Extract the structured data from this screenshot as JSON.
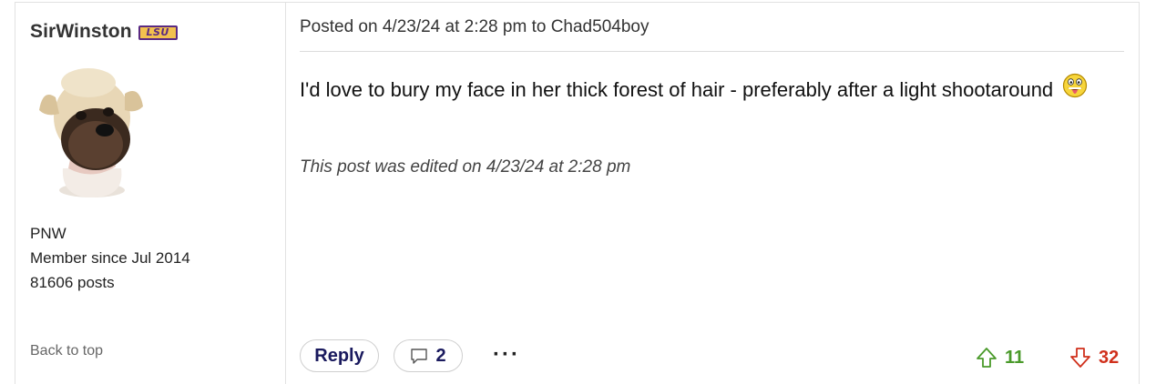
{
  "user": {
    "username": "SirWinston",
    "team_badge": "LSU",
    "location": "PNW",
    "member_since": "Member since Jul 2014",
    "post_count": "81606 posts",
    "back_to_top": "Back to top"
  },
  "post": {
    "header_prefix": "Posted on 4/23/24 at 2:28 pm to ",
    "reply_to_user": "Chad504boy",
    "body": "I'd love to bury my face in her thick forest of hair - preferably after a light shootaround",
    "edited_note": "This post was edited on 4/23/24 at 2:28 pm"
  },
  "actions": {
    "reply_label": "Reply",
    "comment_count": "2",
    "more_label": "···",
    "upvotes": "11",
    "downvotes": "32"
  },
  "colors": {
    "upvote": "#4a9a2a",
    "downvote": "#d0301c",
    "badge_gold": "#f2c14e",
    "badge_purple": "#5a2a82"
  },
  "icons": {
    "emoji": "tongue-out-emoji-icon",
    "comment": "speech-bubble-icon",
    "upvote": "arrow-up-icon",
    "downvote": "arrow-down-icon"
  }
}
